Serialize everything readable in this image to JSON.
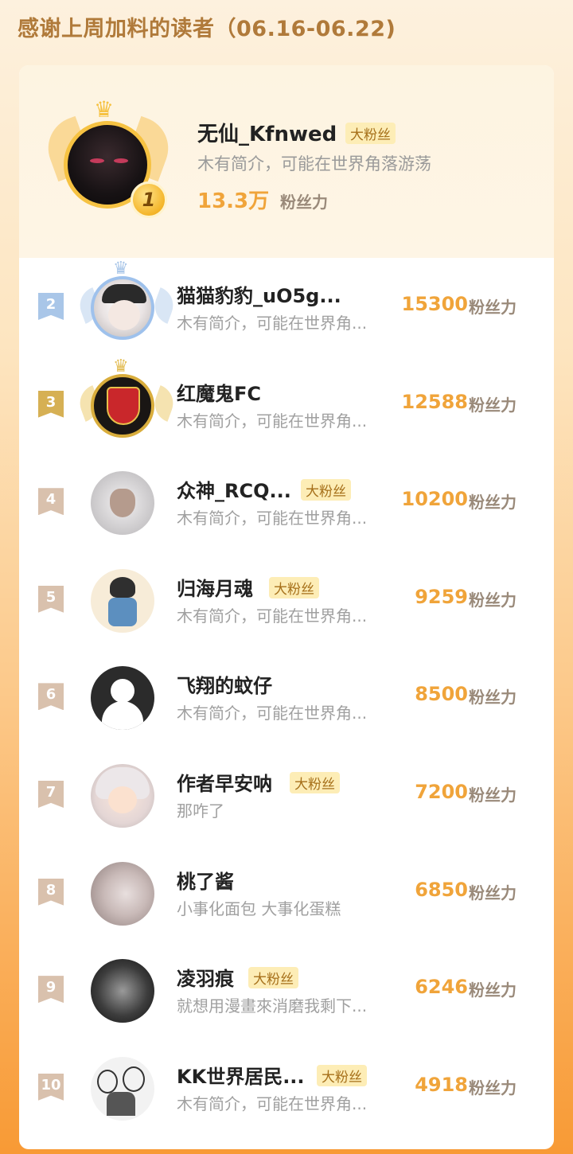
{
  "header": {
    "title": "感谢上周加料的读者（06.16-06.22)"
  },
  "top": {
    "rank": "1",
    "name": "无仙_Kfnwed",
    "badge": "大粉丝",
    "bio": "木有简介，可能在世界角落游荡",
    "score": "13.3万",
    "unit": "粉丝力"
  },
  "rows": [
    {
      "rank": "2",
      "name": "猫猫豹豹_uO5g...",
      "badge": "",
      "bio": "木有简介，可能在世界角...",
      "score": "15300",
      "unit": "粉丝力"
    },
    {
      "rank": "3",
      "name": "红魔鬼FC",
      "badge": "",
      "bio": "木有简介，可能在世界角...",
      "score": "12588",
      "unit": "粉丝力"
    },
    {
      "rank": "4",
      "name": "众神_RCQ...",
      "badge": "大粉丝",
      "bio": "木有简介，可能在世界角...",
      "score": "10200",
      "unit": "粉丝力"
    },
    {
      "rank": "5",
      "name": "归海月魂",
      "badge": "大粉丝",
      "bio": "木有简介，可能在世界角...",
      "score": "9259",
      "unit": "粉丝力"
    },
    {
      "rank": "6",
      "name": "飞翔的蚊仔",
      "badge": "",
      "bio": "木有简介，可能在世界角...",
      "score": "8500",
      "unit": "粉丝力"
    },
    {
      "rank": "7",
      "name": "作者早安呐",
      "badge": "大粉丝",
      "bio": "那咋了",
      "score": "7200",
      "unit": "粉丝力"
    },
    {
      "rank": "8",
      "name": "桃了酱",
      "badge": "",
      "bio": "小事化面包 大事化蛋糕",
      "score": "6850",
      "unit": "粉丝力"
    },
    {
      "rank": "9",
      "name": "凌羽痕",
      "badge": "大粉丝",
      "bio": "就想用漫畫來消磨我剩下...",
      "score": "6246",
      "unit": "粉丝力"
    },
    {
      "rank": "10",
      "name": "KK世界居民...",
      "badge": "大粉丝",
      "bio": "木有简介，可能在世界角...",
      "score": "4918",
      "unit": "粉丝力"
    }
  ]
}
